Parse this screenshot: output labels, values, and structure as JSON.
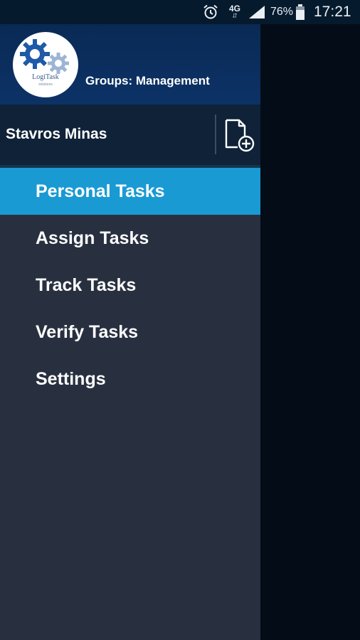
{
  "status_bar": {
    "network": "4G",
    "network_arrows": "⇵",
    "battery_percent": "76%",
    "battery_level": 0.76,
    "time": "17:21",
    "icons": [
      "alarm-icon",
      "network-4g-icon",
      "signal-icon",
      "battery-icon"
    ]
  },
  "drawer": {
    "logo": {
      "text": "LogiTask",
      "subtext": "solutions"
    },
    "groups_label": "Groups: Management",
    "user_name": "Stavros Minas",
    "new_task_icon": "document-add-icon",
    "menu": [
      {
        "label": "Personal Tasks",
        "active": true
      },
      {
        "label": "Assign Tasks",
        "active": false
      },
      {
        "label": "Track Tasks",
        "active": false
      },
      {
        "label": "Verify Tasks",
        "active": false
      },
      {
        "label": "Settings",
        "active": false
      }
    ]
  },
  "colors": {
    "status_bar_bg": "#061a2d",
    "header_bg": "#0c3266",
    "user_row_bg": "#0f2238",
    "drawer_bg": "#283040",
    "active_item_bg": "#1a9ad3",
    "scrim_bg": "#040d17"
  }
}
